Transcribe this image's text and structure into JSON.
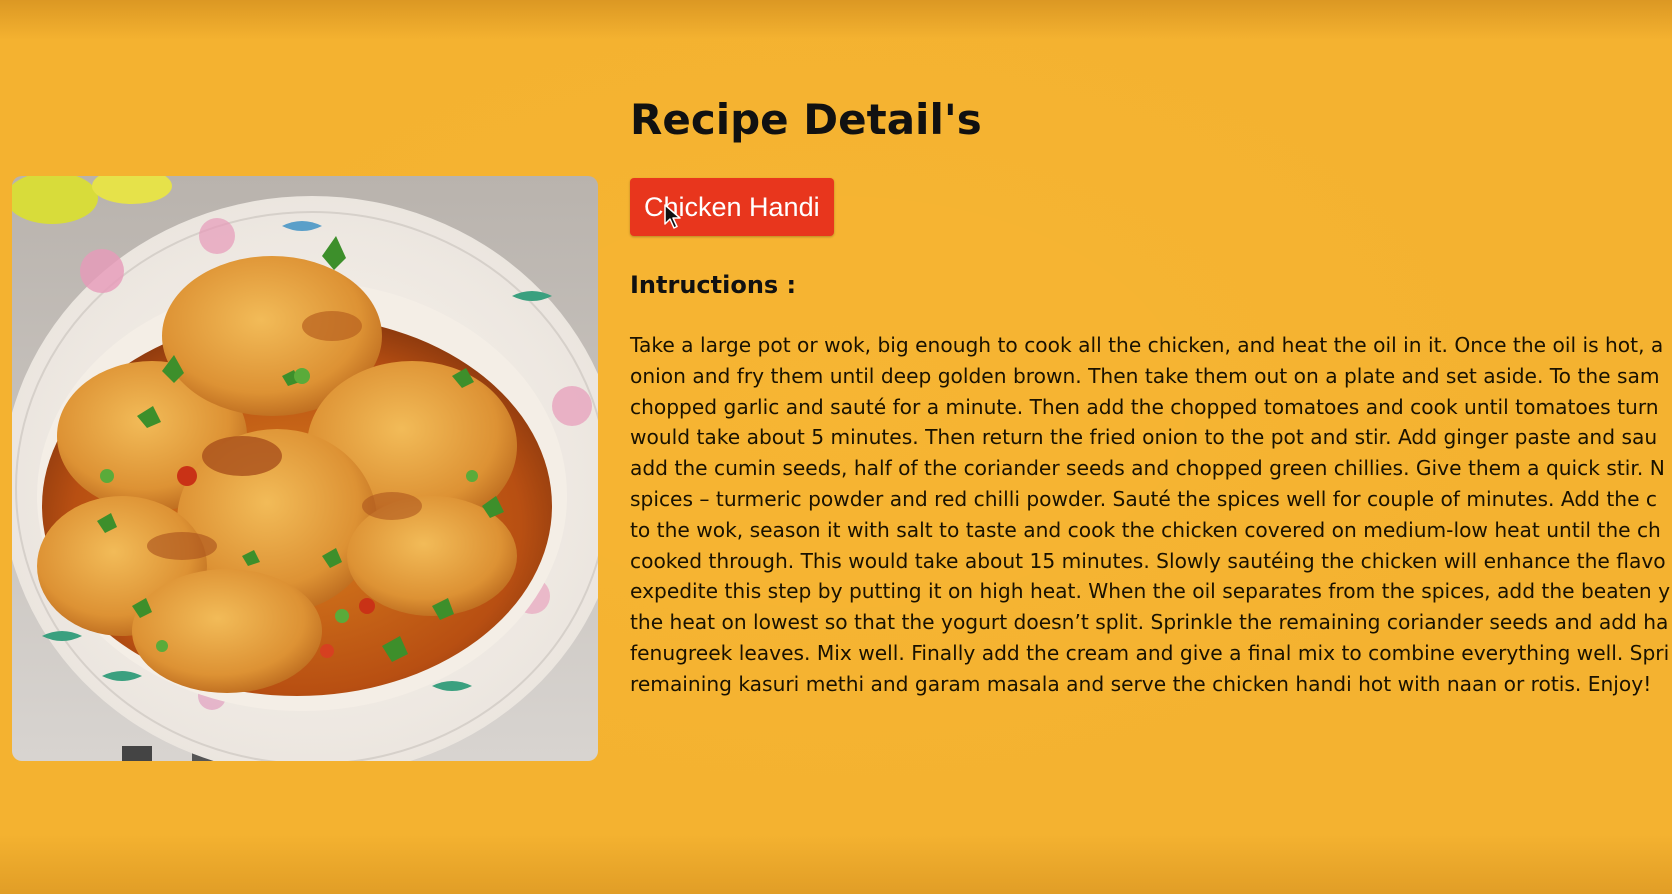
{
  "recipe": {
    "page_title": "Recipe Detail's",
    "name": "Chicken Handi",
    "instructions_heading": "Intructions :",
    "instruction_lines": [
      "Take a large pot or wok, big enough to cook all the chicken, and heat the oil in it. Once the oil is hot, a",
      "onion and fry them until deep golden brown. Then take them out on a plate and set aside. To the sam",
      "chopped garlic and sauté for a minute. Then add the chopped tomatoes and cook until tomatoes turn",
      "would take about 5 minutes. Then return the fried onion to the pot and stir. Add ginger paste and sau",
      "add the cumin seeds, half of the coriander seeds and chopped green chillies. Give them a quick stir. N",
      "spices – turmeric powder and red chilli powder. Sauté the spices well for couple of minutes. Add the c",
      "to the wok, season it with salt to taste and cook the chicken covered on medium-low heat until the ch",
      "cooked through. This would take about 15 minutes. Slowly sautéing the chicken will enhance the flavo",
      "expedite this step by putting it on high heat. When the oil separates from the spices, add the beaten y",
      "the heat on lowest so that the yogurt doesn’t split. Sprinkle the remaining coriander seeds and add ha",
      "fenugreek leaves. Mix well. Finally add the cream and give a final mix to combine everything well. Spri",
      "remaining kasuri methi and garam masala and serve the chicken handi hot with naan or rotis. Enjoy!"
    ]
  },
  "colors": {
    "background": "#f4b230",
    "button": "#e8361d",
    "button_text": "#ffffff"
  },
  "icons": {
    "cursor": "mouse-pointer-icon"
  }
}
